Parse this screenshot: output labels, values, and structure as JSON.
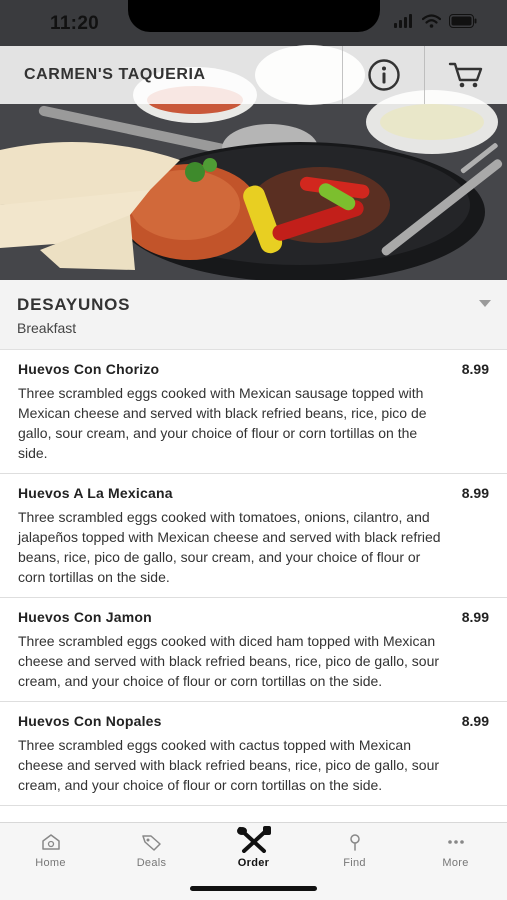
{
  "status_bar": {
    "time": "11:20"
  },
  "header": {
    "title": "CARMEN'S TAQUERIA"
  },
  "category": {
    "title": "DESAYUNOS",
    "subtitle": "Breakfast"
  },
  "items": [
    {
      "name": "Huevos Con Chorizo",
      "price": "8.99",
      "description": "Three scrambled eggs cooked with Mexican sausage topped with Mexican cheese and served with black refried beans, rice, pico de gallo, sour cream, and your choice of flour or corn tortillas on the side."
    },
    {
      "name": "Huevos A La Mexicana",
      "price": "8.99",
      "description": "Three scrambled eggs cooked with tomatoes, onions, cilantro, and jalapeños topped with Mexican cheese and served with black refried beans, rice, pico de gallo, sour cream, and your choice of flour or corn tortillas on the side."
    },
    {
      "name": "Huevos Con Jamon",
      "price": "8.99",
      "description": "Three scrambled eggs cooked with diced ham topped with Mexican cheese and served with black refried beans, rice, pico de gallo, sour cream, and your choice of flour or corn tortillas on the side."
    },
    {
      "name": "Huevos Con Nopales",
      "price": "8.99",
      "description": "Three scrambled eggs cooked with cactus topped with Mexican cheese and served with black refried beans, rice, pico de gallo, sour cream, and your choice of flour or corn tortillas on the side."
    }
  ],
  "tabs": [
    {
      "label": "Home",
      "icon": "home-icon"
    },
    {
      "label": "Deals",
      "icon": "tag-icon"
    },
    {
      "label": "Order",
      "icon": "utensils-icon",
      "active": true
    },
    {
      "label": "Find",
      "icon": "pin-icon"
    },
    {
      "label": "More",
      "icon": "ellipsis-icon"
    }
  ]
}
